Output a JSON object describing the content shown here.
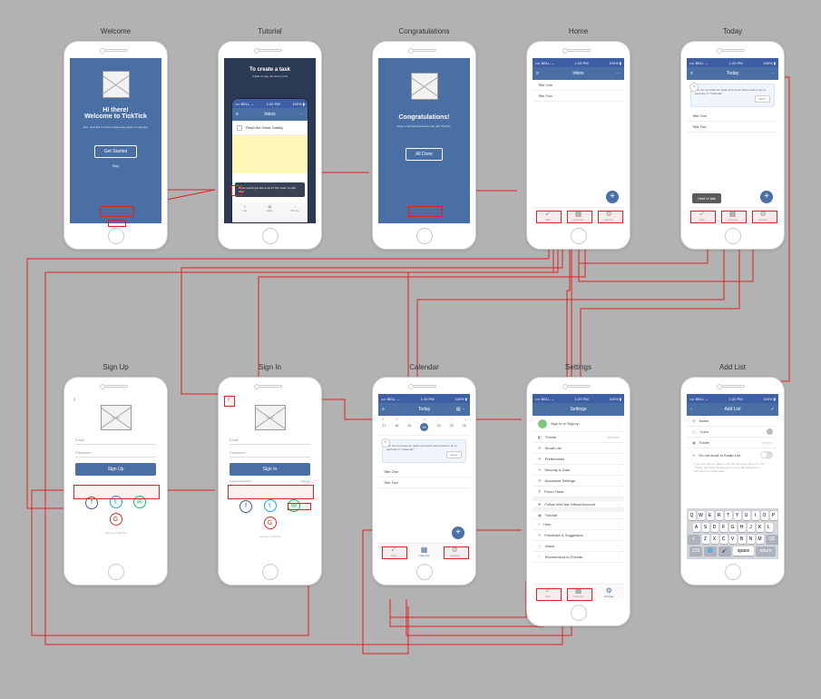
{
  "status": {
    "left": "•••• BELL ⌄",
    "time": "1:20 PM",
    "right": "100% ▮"
  },
  "screens": {
    "welcome": {
      "title": "Welcome",
      "h1": "Hi there!",
      "h2": "Welcome to TickTick",
      "sub": "Also, we'd like to show a three-step guide so long ago.",
      "button": "Get Started",
      "skip": "Skip"
    },
    "tutorial": {
      "title": "Tutorial",
      "heading": "To create a task",
      "sub": "A task or step can first try this",
      "nav": "Inbox",
      "task": "Read the Great Gatsby",
      "tip": "When would you like to do it? Tap \"date\" to pick date.",
      "buttons": [
        "List",
        "Date",
        "Priority"
      ]
    },
    "congrats": {
      "title": "Congratulations",
      "h1": "Congratulations!",
      "sub": "Enjoy a wonderful assistant life with TickTick.",
      "button": "All Done"
    },
    "home": {
      "title": "Home",
      "nav": "Inbox",
      "items": [
        "Title One",
        "Title Two"
      ],
      "tabs": [
        "Task",
        "Calendar",
        "Settings"
      ]
    },
    "today": {
      "title": "Today",
      "nav": "Today",
      "tip": "You can set dates for tasks and check what needs to be on each day in \"Calendar\".",
      "got": "Got It",
      "items": [
        "Title One",
        "Title Two"
      ],
      "hold": "Hold to talk"
    },
    "signup": {
      "title": "Sign Up",
      "image": "Image",
      "email": "Email",
      "password": "Password",
      "button": "Sign Up",
      "foot": "Agree on TickTick"
    },
    "signin": {
      "title": "Sign In",
      "image": "Image",
      "email": "Email",
      "password": "Password",
      "button": "Sign In",
      "forgot": "Forgot Password?",
      "signup": "Sign Up",
      "foot": "Agree on TickTick"
    },
    "calendar": {
      "title": "Calendar",
      "nav": "Today",
      "days": [
        "S",
        "M",
        "T",
        "W",
        "T",
        "F",
        "S"
      ],
      "dates": [
        "17",
        "18",
        "19",
        "20",
        "21",
        "22",
        "23"
      ],
      "tip": "You can set dates for tasks and check what needs to be on each day in \"Calendar\".",
      "got": "Got It",
      "items": [
        "Title One",
        "Title Two"
      ]
    },
    "settings": {
      "title": "Settings",
      "nav": "Settings",
      "signin": "Sign in or Sign up",
      "rows": [
        {
          "icon": "◧",
          "label": "Theme",
          "value": "Default"
        },
        {
          "icon": "☰",
          "label": "Smart List",
          "value": ""
        },
        {
          "icon": "⚙",
          "label": "Preferences",
          "value": ""
        },
        {
          "icon": "⟲",
          "label": "Security & Data",
          "value": ""
        },
        {
          "icon": "⚒",
          "label": "Advanced Settings",
          "value": ""
        },
        {
          "icon": "⏱",
          "label": "Pomo Timer",
          "value": ""
        },
        {
          "icon": "✚",
          "label": "Follow WeChat Official Account",
          "value": ""
        },
        {
          "icon": "▣",
          "label": "Tutorial",
          "value": ""
        },
        {
          "icon": "?",
          "label": "Help",
          "value": ""
        },
        {
          "icon": "✎",
          "label": "Feedback & Suggestion",
          "value": ""
        },
        {
          "icon": "ⓘ",
          "label": "About",
          "value": ""
        },
        {
          "icon": "♡",
          "label": "Recommend to Friends",
          "value": ""
        }
      ]
    },
    "addlist": {
      "title": "Add List",
      "nav": "Add List",
      "name": "Name",
      "color": "Color",
      "folder": "Folder",
      "folderval": "None  ›",
      "hide": "Do not show in Smart List",
      "hint": "If you turn this on, tasks in this list will not be shown in \"All\", \"Today\" and other Smart Lists, but you will still receive reminders for these tasks.",
      "keys": {
        "r1": [
          "Q",
          "W",
          "E",
          "R",
          "T",
          "Y",
          "U",
          "I",
          "O",
          "P"
        ],
        "r2": [
          "A",
          "S",
          "D",
          "F",
          "G",
          "H",
          "J",
          "K",
          "L"
        ],
        "r3": [
          "Z",
          "X",
          "C",
          "V",
          "B",
          "N",
          "M"
        ],
        "shift": "⇧",
        "del": "⌫",
        "num": "123",
        "globe": "🌐",
        "mic": "🎤",
        "space": "space",
        "ret": "return"
      }
    }
  }
}
